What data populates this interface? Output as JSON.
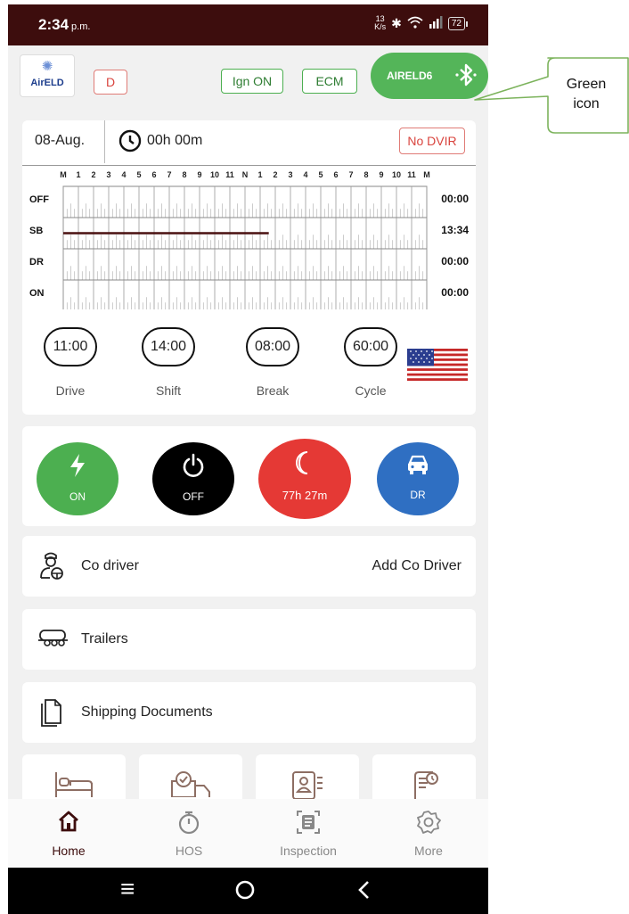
{
  "status_bar": {
    "time": "2:34",
    "ampm": "p.m.",
    "net_speed_value": "13",
    "net_speed_unit": "K/s",
    "battery": "72"
  },
  "header": {
    "logo_text": "AirELD",
    "duty_badge": "D",
    "ign_label": "Ign ON",
    "ecm_label": "ECM",
    "device_label": "AIRELD6",
    "bluetooth_icon": "bluetooth-icon",
    "device_color": "#54b559"
  },
  "log": {
    "date": "08-Aug.",
    "duration": "00h 00m",
    "dvir_label": "No DVIR",
    "hour_labels": [
      "M",
      "1",
      "2",
      "3",
      "4",
      "5",
      "6",
      "7",
      "8",
      "9",
      "10",
      "11",
      "N",
      "1",
      "2",
      "3",
      "4",
      "5",
      "6",
      "7",
      "8",
      "9",
      "10",
      "11",
      "M"
    ],
    "rows": [
      {
        "label": "OFF",
        "total": "00:00"
      },
      {
        "label": "SB",
        "total": "13:34"
      },
      {
        "label": "DR",
        "total": "00:00"
      },
      {
        "label": "ON",
        "total": "00:00"
      }
    ],
    "sb_segment_hours": [
      0,
      13.57
    ],
    "timers": [
      {
        "value": "11:00",
        "label": "Drive"
      },
      {
        "value": "14:00",
        "label": "Shift"
      },
      {
        "value": "08:00",
        "label": "Break"
      },
      {
        "value": "60:00",
        "label": "Cycle"
      }
    ],
    "country_flag": "us-flag-icon"
  },
  "status_buttons": [
    {
      "label": "ON",
      "icon": "lightning-icon",
      "color": "#4caf50"
    },
    {
      "label": "OFF",
      "icon": "power-icon",
      "color": "#000000"
    },
    {
      "label": "77h 27m",
      "icon": "moon-icon",
      "color": "#e53935"
    },
    {
      "label": "DR",
      "icon": "car-icon",
      "color": "#2f6fc2"
    }
  ],
  "rows": {
    "co_driver": "Co driver",
    "add_co_driver": "Add Co Driver",
    "trailers": "Trailers",
    "shipping": "Shipping Documents"
  },
  "bottom_nav": [
    {
      "label": "Home",
      "icon": "home-icon",
      "active": true
    },
    {
      "label": "HOS",
      "icon": "stopwatch-icon",
      "active": false
    },
    {
      "label": "Inspection",
      "icon": "inspection-icon",
      "active": false
    },
    {
      "label": "More",
      "icon": "gear-icon",
      "active": false
    }
  ],
  "callout": {
    "line1": "Green",
    "line2": "icon"
  }
}
